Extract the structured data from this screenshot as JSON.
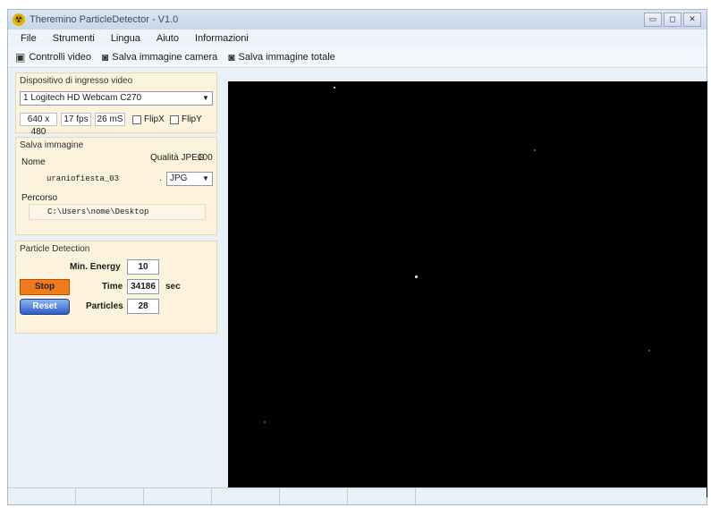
{
  "window": {
    "title": "Theremino ParticleDetector - V1.0"
  },
  "window_buttons": {
    "minimize": "▭",
    "maximize": "◻",
    "close": "✕"
  },
  "menu": [
    "File",
    "Strumenti",
    "Lingua",
    "Aiuto",
    "Informazioni"
  ],
  "toolbar": {
    "video_controls": "Controlli video",
    "save_camera": "Salva immagine camera",
    "save_total": "Salva immagine totale"
  },
  "video_device": {
    "title": "Dispositivo di ingresso video",
    "selected": "1 Logitech HD Webcam C270",
    "resolution": "640 x 480",
    "fps": "17 fps",
    "ms": "26 mS",
    "flip_x_label": "FlipX",
    "flip_y_label": "FlipY"
  },
  "save_image": {
    "title": "Salva immagine",
    "name_label": "Nome",
    "quality_label": "Qualità JPEG",
    "quality_value": "100",
    "name_value": "uraniofiesta_03",
    "dot": ".",
    "format": "JPG",
    "path_label": "Percorso",
    "path_value": "C:\\Users\\nome\\Desktop"
  },
  "particle_detection": {
    "title": "Particle Detection",
    "min_energy_label": "Min. Energy",
    "min_energy_value": "10",
    "stop_label": "Stop",
    "time_label": "Time",
    "time_value": "34186",
    "time_unit": "sec",
    "reset_label": "Reset",
    "particles_label": "Particles",
    "particles_value": "28"
  },
  "colors": {
    "stop_button": "#f07a1c",
    "reset_button": "#2d5ec9",
    "panel_bg": "#fdf3dc",
    "video_bg": "#000000"
  }
}
